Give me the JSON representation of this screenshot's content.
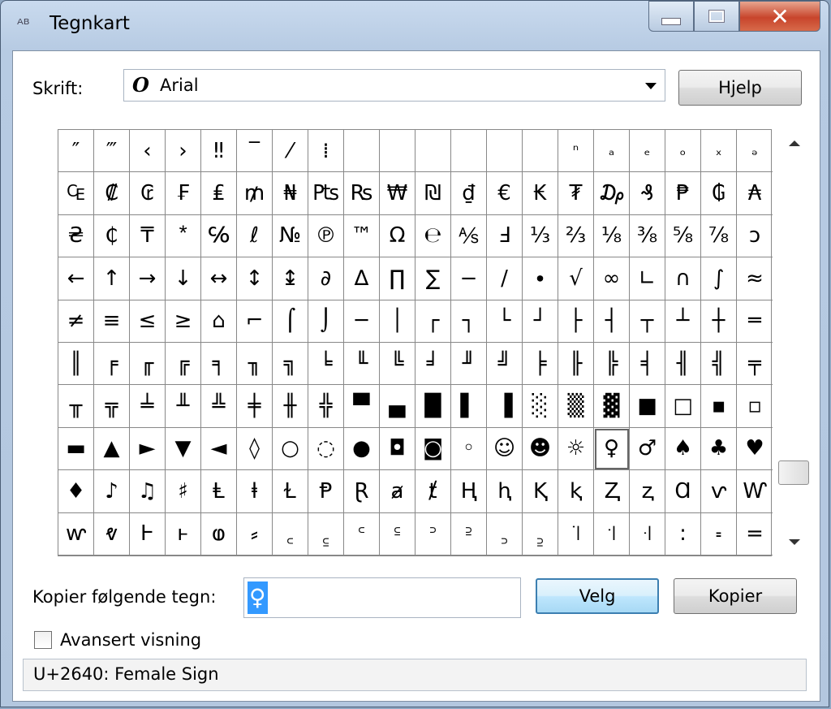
{
  "window": {
    "title": "Tegnkart"
  },
  "font": {
    "label": "Skrift:",
    "selected": "Arial"
  },
  "buttons": {
    "help": "Hjelp",
    "select": "Velg",
    "copy": "Kopier"
  },
  "copy": {
    "label": "Kopier følgende tegn:",
    "value": "♀"
  },
  "advanced": {
    "label": "Avansert visning",
    "checked": false
  },
  "status": {
    "text": "U+2640: Female Sign"
  },
  "grid": {
    "selected_row": 7,
    "selected_col": 15,
    "rows": [
      [
        "″",
        "‴",
        "‹",
        "›",
        "‼",
        "‾",
        "⁄",
        "⁞",
        "",
        "",
        "",
        "",
        "",
        "",
        "ⁿ",
        "ₐ",
        "ₑ",
        "ₒ",
        "ₓ",
        "ₔ"
      ],
      [
        "₠",
        "₡",
        "₢",
        "₣",
        "₤",
        "₥",
        "₦",
        "₧",
        "₨",
        "₩",
        "₪",
        "₫",
        "€",
        "₭",
        "₮",
        "₯",
        "₰",
        "₱",
        "₲",
        "₳"
      ],
      [
        "₴",
        "₵",
        "₸",
        "⃰",
        "℅",
        "ℓ",
        "№",
        "℗",
        "™",
        "Ω",
        "℮",
        "⅍",
        "Ⅎ",
        "⅓",
        "⅔",
        "⅛",
        "⅜",
        "⅝",
        "⅞",
        "ↄ"
      ],
      [
        "←",
        "↑",
        "→",
        "↓",
        "↔",
        "↕",
        "↨",
        "∂",
        "∆",
        "∏",
        "∑",
        "−",
        "∕",
        "∙",
        "√",
        "∞",
        "∟",
        "∩",
        "∫",
        "≈"
      ],
      [
        "≠",
        "≡",
        "≤",
        "≥",
        "⌂",
        "⌐",
        "⌠",
        "⌡",
        "─",
        "│",
        "┌",
        "┐",
        "└",
        "┘",
        "├",
        "┤",
        "┬",
        "┴",
        "┼",
        "═"
      ],
      [
        "║",
        "╒",
        "╓",
        "╔",
        "╕",
        "╖",
        "╗",
        "╘",
        "╙",
        "╚",
        "╛",
        "╜",
        "╝",
        "╞",
        "╟",
        "╠",
        "╡",
        "╢",
        "╣",
        "╤"
      ],
      [
        "╥",
        "╦",
        "╧",
        "╨",
        "╩",
        "╪",
        "╫",
        "╬",
        "▀",
        "▄",
        "█",
        "▌",
        "▐",
        "░",
        "▒",
        "▓",
        "■",
        "□",
        "▪",
        "▫"
      ],
      [
        "▬",
        "▲",
        "►",
        "▼",
        "◄",
        "◊",
        "○",
        "◌",
        "●",
        "◘",
        "◙",
        "◦",
        "☺",
        "☻",
        "☼",
        "♀",
        "♂",
        "♠",
        "♣",
        "♥"
      ],
      [
        "♦",
        "♪",
        "♫",
        "♯",
        "Ⱡ",
        "ⱡ",
        "Ɫ",
        "Ᵽ",
        "Ɽ",
        "ⱥ",
        "ⱦ",
        "Ⱨ",
        "ⱨ",
        "Ⱪ",
        "ⱪ",
        "Ⱬ",
        "ⱬ",
        "Ɑ",
        "ⱱ",
        "Ⱳ"
      ],
      [
        "ⱳ",
        "ⱴ",
        "Ⱶ",
        "ⱶ",
        "ⱷ",
        "⸗",
        "꜀",
        "꜁",
        "꜂",
        "꜃",
        "꜄",
        "꜅",
        "꜆",
        "꜇",
        "꜈",
        "꜉",
        "꜊",
        "꞉",
        "꞊",
        "="
      ]
    ]
  }
}
